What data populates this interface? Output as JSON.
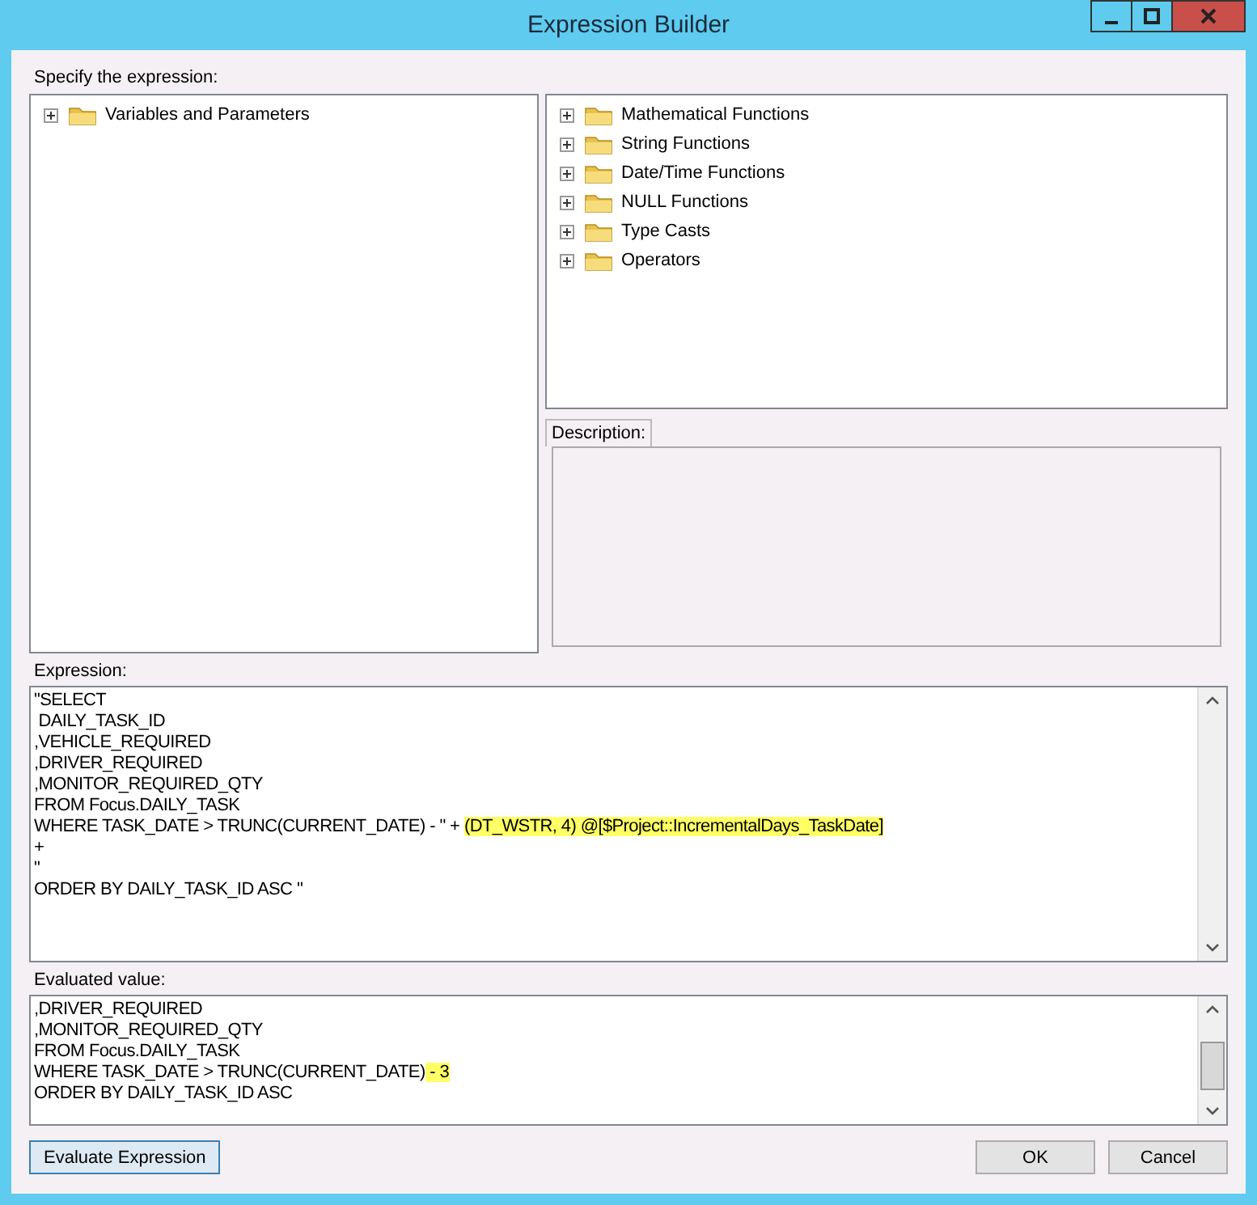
{
  "window": {
    "title": "Expression Builder"
  },
  "specify_label": "Specify the expression:",
  "variables_tree": {
    "items": [
      {
        "label": "Variables and Parameters",
        "expanded": false
      }
    ]
  },
  "functions_tree": {
    "items": [
      {
        "label": "Mathematical Functions",
        "expanded": false
      },
      {
        "label": "String Functions",
        "expanded": false
      },
      {
        "label": "Date/Time Functions",
        "expanded": false
      },
      {
        "label": "NULL Functions",
        "expanded": false
      },
      {
        "label": "Type Casts",
        "expanded": false
      },
      {
        "label": "Operators",
        "expanded": false
      }
    ]
  },
  "description": {
    "label": "Description:"
  },
  "expression": {
    "label": "Expression:",
    "lines": [
      [
        {
          "text": "\"SELECT",
          "highlighted": false
        }
      ],
      [
        {
          "text": " DAILY_TASK_ID",
          "highlighted": false
        }
      ],
      [
        {
          "text": ",VEHICLE_REQUIRED",
          "highlighted": false
        }
      ],
      [
        {
          "text": ",DRIVER_REQUIRED",
          "highlighted": false
        }
      ],
      [
        {
          "text": ",MONITOR_REQUIRED_QTY",
          "highlighted": false
        }
      ],
      [
        {
          "text": "FROM Focus.DAILY_TASK",
          "highlighted": false
        }
      ],
      [
        {
          "text": "WHERE TASK_DATE > TRUNC(CURRENT_DATE) - \" + ",
          "highlighted": false
        },
        {
          "text": "(DT_WSTR, 4) @[$Project::IncrementalDays_TaskDate]",
          "highlighted": true
        }
      ],
      [
        {
          "text": "+",
          "highlighted": false
        }
      ],
      [
        {
          "text": "\"",
          "highlighted": false
        }
      ],
      [
        {
          "text": "ORDER BY DAILY_TASK_ID ASC \"",
          "highlighted": false
        }
      ]
    ]
  },
  "evaluated_value": {
    "label": "Evaluated value:",
    "lines": [
      [
        {
          "text": ",DRIVER_REQUIRED",
          "highlighted": false
        }
      ],
      [
        {
          "text": ",MONITOR_REQUIRED_QTY",
          "highlighted": false
        }
      ],
      [
        {
          "text": "FROM Focus.DAILY_TASK",
          "highlighted": false
        }
      ],
      [
        {
          "text": "WHERE TASK_DATE > TRUNC(CURRENT_DATE)",
          "highlighted": false
        },
        {
          "text": " - 3",
          "highlighted": true
        }
      ],
      [
        {
          "text": "ORDER BY DAILY_TASK_ID ASC",
          "highlighted": false
        }
      ]
    ]
  },
  "buttons": {
    "evaluate": "Evaluate Expression",
    "ok": "OK",
    "cancel": "Cancel"
  }
}
